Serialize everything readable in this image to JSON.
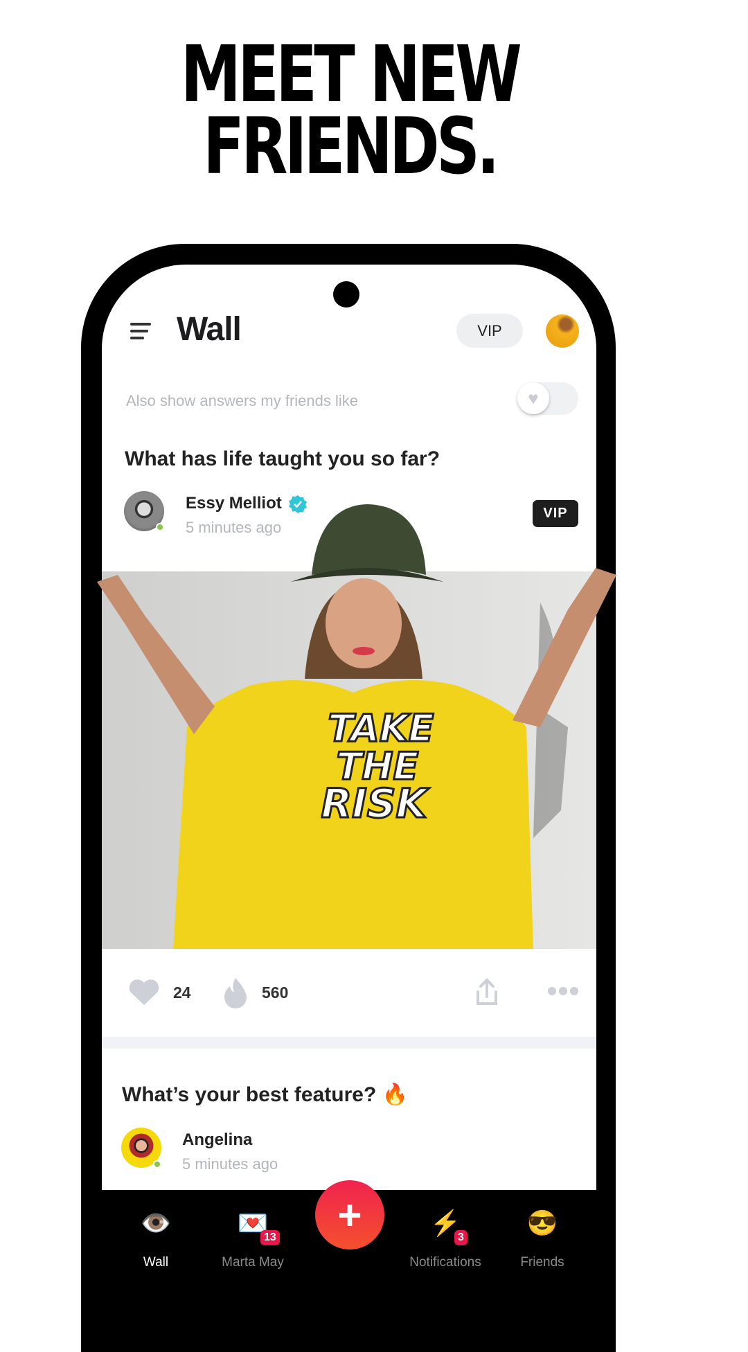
{
  "headline": {
    "line1": "MEET NEW",
    "line2": "FRIENDS."
  },
  "header": {
    "title": "Wall",
    "vip_label": "VIP",
    "menu_icon": "hamburger-icon",
    "avatar": "user-avatar"
  },
  "filter": {
    "label": "Also show answers my friends like",
    "toggle_on": false,
    "toggle_icon": "heart-icon"
  },
  "posts": [
    {
      "question": "What has life taught you so far?",
      "author": "Essy Melliot",
      "verified": true,
      "time": "5 minutes ago",
      "badge": "VIP",
      "online": true,
      "image_text": [
        "TAKE",
        "THE",
        "RISK"
      ],
      "likes": "24",
      "fires": "560"
    },
    {
      "question": "What’s your best feature? 🔥",
      "author": "Angelina",
      "time": "5 minutes ago",
      "online": true
    }
  ],
  "nav": {
    "items": [
      {
        "label": "Wall",
        "icon": "👁️",
        "active": true
      },
      {
        "label": "Marta May",
        "icon": "💌",
        "badge": "13"
      },
      {
        "label": "Notifications",
        "icon": "⚡",
        "badge": "3"
      },
      {
        "label": "Friends",
        "icon": "😎"
      }
    ],
    "add_icon": "+"
  },
  "colors": {
    "accent": "#f0234e",
    "vip_dark": "#1e1e1e",
    "online": "#8bc34a",
    "shirt": "#f2d31b"
  }
}
